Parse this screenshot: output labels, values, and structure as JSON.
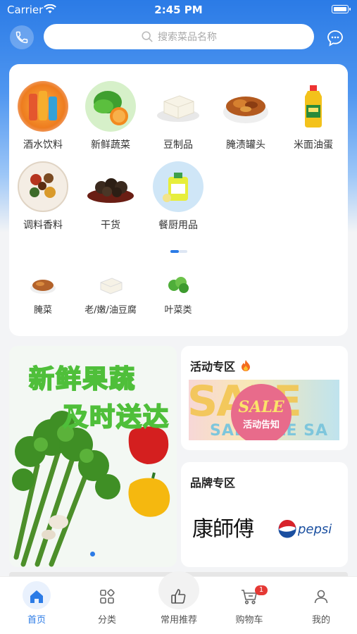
{
  "status": {
    "carrier": "Carrier",
    "time": "2:45 PM"
  },
  "search": {
    "placeholder": "搜索菜品名称"
  },
  "categories": [
    {
      "label": "酒水饮料",
      "icon": "drinks-icon"
    },
    {
      "label": "新鲜蔬菜",
      "icon": "vegetables-icon"
    },
    {
      "label": "豆制品",
      "icon": "tofu-icon"
    },
    {
      "label": "腌渍罐头",
      "icon": "pickles-icon"
    },
    {
      "label": "米面油蛋",
      "icon": "oil-bottle-icon"
    },
    {
      "label": "调料香料",
      "icon": "spices-icon"
    },
    {
      "label": "干货",
      "icon": "mushrooms-icon"
    },
    {
      "label": "餐厨用品",
      "icon": "kitchen-supplies-icon"
    }
  ],
  "subcategories": [
    {
      "label": "腌菜"
    },
    {
      "label": "老/嫩/油豆腐"
    },
    {
      "label": "叶菜类"
    }
  ],
  "banner": {
    "line1": "新鲜果蔬",
    "line2": "及时送达"
  },
  "promo": {
    "title": "活动专区",
    "sale_word": "SALE",
    "sale_sub": "活动告知",
    "sale_bg": "SALE",
    "sale_bg2": "SAL SALE SA"
  },
  "brand": {
    "title": "品牌专区",
    "logo1": "康師傅",
    "logo2": "pepsi"
  },
  "tabs": [
    {
      "label": "首页",
      "icon": "home-icon",
      "active": true
    },
    {
      "label": "分类",
      "icon": "category-icon"
    },
    {
      "label": "常用推荐",
      "icon": "thumbs-up-icon"
    },
    {
      "label": "购物车",
      "icon": "cart-icon",
      "badge": "1"
    },
    {
      "label": "我的",
      "icon": "profile-icon"
    }
  ],
  "colors": {
    "primary": "#2b7be6",
    "badge": "#e53935"
  }
}
